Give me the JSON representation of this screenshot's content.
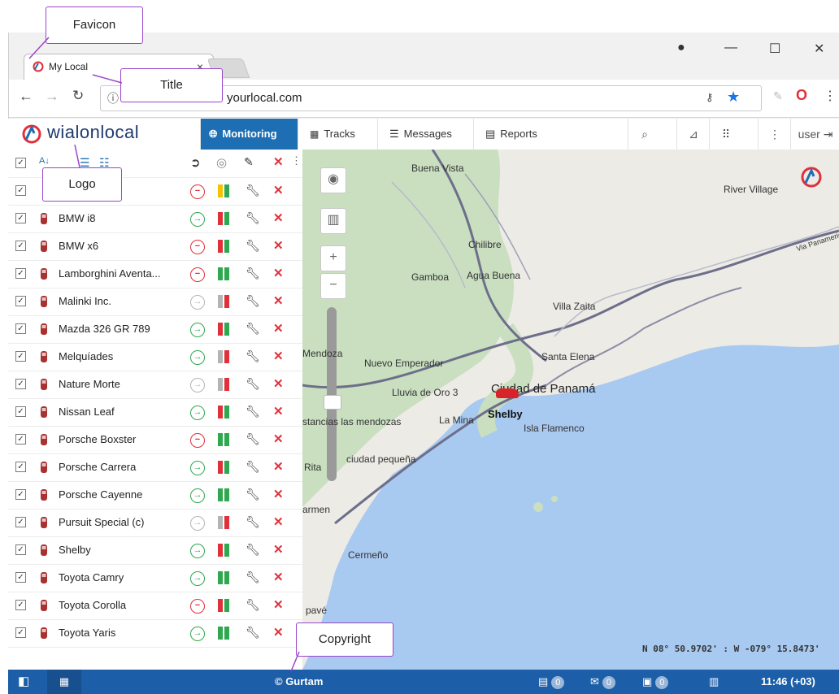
{
  "browser": {
    "tab_title": "My Local",
    "tab_close": "×",
    "address": "yourlocal.com",
    "win_min": "—",
    "win_max": "☐",
    "win_close": "✕"
  },
  "app": {
    "logo_text": "wialonlocal",
    "menu": [
      {
        "label": "Monitoring",
        "icon": "globe-icon",
        "active": true
      },
      {
        "label": "Tracks",
        "icon": "tracks-icon"
      },
      {
        "label": "Messages",
        "icon": "messages-icon"
      },
      {
        "label": "Reports",
        "icon": "reports-icon"
      }
    ],
    "user_label": "user"
  },
  "units": [
    {
      "name": "BMW i8",
      "status": "go",
      "bars": [
        "#e0303a",
        "#2fa84f"
      ]
    },
    {
      "name": "BMW x6",
      "status": "stop",
      "bars": [
        "#e0303a",
        "#2fa84f"
      ]
    },
    {
      "name": "Lamborghini Aventa...",
      "status": "stop",
      "bars": [
        "#2fa84f",
        "#2fa84f"
      ]
    },
    {
      "name": "Malinki Inc.",
      "status": "off",
      "bars": [
        "#b4b4b4",
        "#e0303a"
      ]
    },
    {
      "name": "Mazda 326 GR 789",
      "status": "go",
      "bars": [
        "#e0303a",
        "#2fa84f"
      ]
    },
    {
      "name": "Melquíades",
      "status": "go",
      "bars": [
        "#b4b4b4",
        "#e0303a"
      ]
    },
    {
      "name": "Nature Morte",
      "status": "off",
      "bars": [
        "#b4b4b4",
        "#e0303a"
      ]
    },
    {
      "name": "Nissan Leaf",
      "status": "go",
      "bars": [
        "#e0303a",
        "#2fa84f"
      ]
    },
    {
      "name": "Porsche Boxster",
      "status": "stop",
      "bars": [
        "#2fa84f",
        "#2fa84f"
      ]
    },
    {
      "name": "Porsche Carrera",
      "status": "go",
      "bars": [
        "#e0303a",
        "#2fa84f"
      ]
    },
    {
      "name": "Porsche Cayenne",
      "status": "go",
      "bars": [
        "#2fa84f",
        "#2fa84f"
      ]
    },
    {
      "name": "Pursuit Special (c)",
      "status": "off",
      "bars": [
        "#b4b4b4",
        "#e0303a"
      ]
    },
    {
      "name": "Shelby",
      "status": "go",
      "bars": [
        "#e0303a",
        "#2fa84f"
      ]
    },
    {
      "name": "Toyota Camry",
      "status": "go",
      "bars": [
        "#2fa84f",
        "#2fa84f"
      ]
    },
    {
      "name": "Toyota Corolla",
      "status": "stop",
      "bars": [
        "#e0303a",
        "#2fa84f"
      ]
    },
    {
      "name": "Toyota Yaris",
      "status": "go",
      "bars": [
        "#2fa84f",
        "#2fa84f"
      ]
    }
  ],
  "map": {
    "labels": [
      "Buena Vista",
      "River Village",
      "Chilibre",
      "Gamboa",
      "Agua Buena",
      "Villa Zaita",
      "Mendoza",
      "Nuevo Emperador",
      "Santa Elena",
      "Ciudad de Panamá",
      "Lluvia de Oro 3",
      "Shelby",
      "Isla Flamenco",
      "La Mina",
      "stancias las mendozas",
      "Rita",
      "ciudad pequeña",
      "armen",
      "Cermeño",
      "pavé",
      "Via Panamericana"
    ],
    "coordinates": "N 08° 50.9702' : W -079° 15.8473'"
  },
  "bottom": {
    "copyright": "© Gurtam",
    "count1": "0",
    "count2": "0",
    "count3": "0",
    "time": "11:46 (+03)"
  },
  "callouts": {
    "favicon": "Favicon",
    "title": "Title",
    "logo": "Logo",
    "copyright": "Copyright"
  },
  "colors": {
    "accent": "#1e6eb4",
    "bottom_bar": "#1c5ea8",
    "callout_border": "#9b45c9",
    "go": "#2fa84f",
    "stop": "#e0303a"
  }
}
